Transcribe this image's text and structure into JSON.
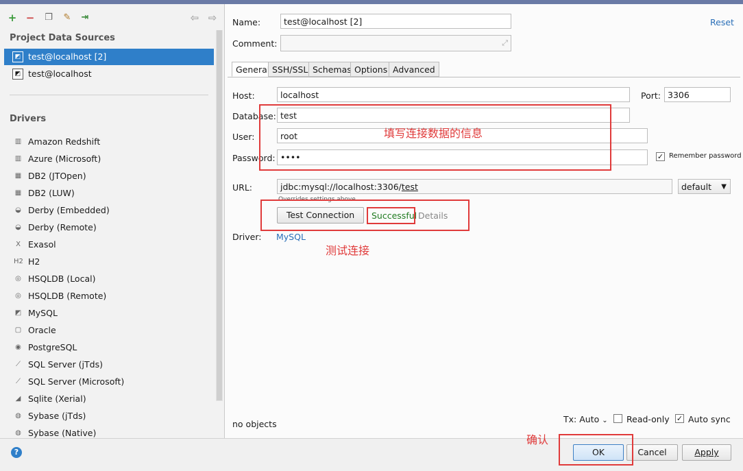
{
  "toolbar": {
    "icons": [
      "add-icon",
      "remove-icon",
      "copy-icon",
      "wrench-icon",
      "import-icon",
      "back-icon",
      "forward-icon"
    ]
  },
  "left": {
    "project_title": "Project Data Sources",
    "datasources": [
      {
        "label": "test@localhost [2]",
        "selected": true
      },
      {
        "label": "test@localhost",
        "selected": false
      }
    ],
    "drivers_title": "Drivers",
    "drivers": [
      {
        "label": "Amazon Redshift",
        "icon": "▥"
      },
      {
        "label": "Azure (Microsoft)",
        "icon": "▥"
      },
      {
        "label": "DB2 (JTOpen)",
        "icon": "▦"
      },
      {
        "label": "DB2 (LUW)",
        "icon": "▦"
      },
      {
        "label": "Derby (Embedded)",
        "icon": "◒"
      },
      {
        "label": "Derby (Remote)",
        "icon": "◒"
      },
      {
        "label": "Exasol",
        "icon": "X"
      },
      {
        "label": "H2",
        "icon": "H2"
      },
      {
        "label": "HSQLDB (Local)",
        "icon": "◎"
      },
      {
        "label": "HSQLDB (Remote)",
        "icon": "◎"
      },
      {
        "label": "MySQL",
        "icon": "◩"
      },
      {
        "label": "Oracle",
        "icon": "▢"
      },
      {
        "label": "PostgreSQL",
        "icon": "◉"
      },
      {
        "label": "SQL Server (jTds)",
        "icon": "⟋"
      },
      {
        "label": "SQL Server (Microsoft)",
        "icon": "⟋"
      },
      {
        "label": "Sqlite (Xerial)",
        "icon": "◢"
      },
      {
        "label": "Sybase (jTds)",
        "icon": "◍"
      },
      {
        "label": "Sybase (Native)",
        "icon": "◍"
      }
    ]
  },
  "form": {
    "name_label": "Name:",
    "name_value": "test@localhost [2]",
    "reset": "Reset",
    "comment_label": "Comment:",
    "tabs": [
      "General",
      "SSH/SSL",
      "Schemas",
      "Options",
      "Advanced"
    ],
    "host_label": "Host:",
    "host_value": "localhost",
    "port_label": "Port:",
    "port_value": "3306",
    "database_label": "Database:",
    "database_value": "test",
    "user_label": "User:",
    "user_value": "root",
    "password_label": "Password:",
    "password_value": "••••",
    "remember_label": "Remember password",
    "url_label": "URL:",
    "url_prefix": "jdbc:mysql://localhost:3306/",
    "url_db": "test",
    "url_mode": "default",
    "overrides": "Overrides settings above",
    "test_button": "Test Connection",
    "test_result": "Successful",
    "details": "Details",
    "driver_label": "Driver:",
    "driver_value": "MySQL",
    "no_objects": "no objects",
    "tx_label": "Tx: Auto",
    "readonly_label": "Read-only",
    "autosync_label": "Auto sync"
  },
  "annotations": {
    "fill_info": "填写连接数据的信息",
    "test_conn": "测试连接",
    "confirm": "确认"
  },
  "buttons": {
    "ok": "OK",
    "cancel": "Cancel",
    "apply": "Apply"
  },
  "colors": {
    "selection": "#2f7fc9",
    "annotation_red": "#e03a3a",
    "success_green": "#1f7a1f",
    "link_blue": "#2a6fb8"
  }
}
